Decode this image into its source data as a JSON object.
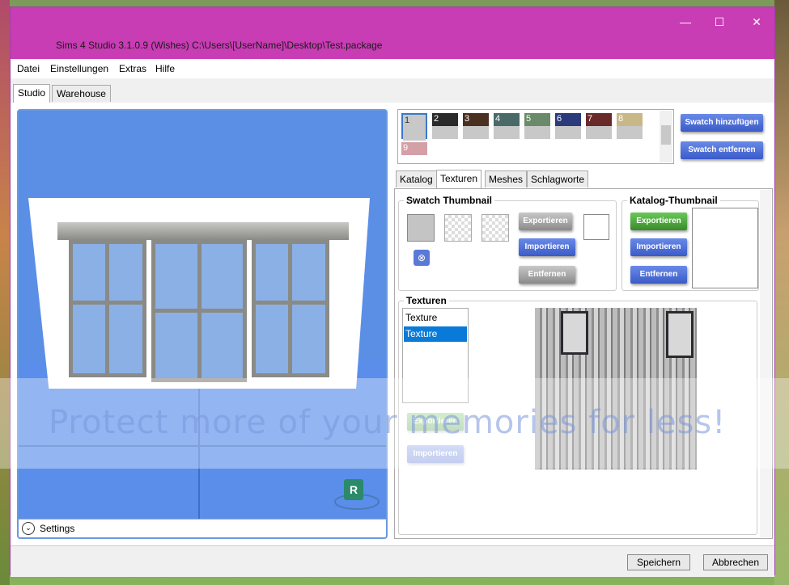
{
  "window": {
    "title": "Sims 4 Studio 3.1.0.9 (Wishes)  C:\\Users\\[UserName]\\Desktop\\Test.package",
    "controls": {
      "minimize": "—",
      "maximize": "☐",
      "close": "✕"
    }
  },
  "menu": [
    "Datei",
    "Einstellungen",
    "Extras",
    "Hilfe"
  ],
  "main_tabs": [
    "Studio",
    "Warehouse"
  ],
  "preview": {
    "settings_label": "Settings",
    "chevron": "⌄",
    "badge": "R"
  },
  "swatches": [
    {
      "num": "1",
      "color": "#c8c8c8",
      "selected": true
    },
    {
      "num": "2",
      "color": "#2a2a2a"
    },
    {
      "num": "3",
      "color": "#4a3020"
    },
    {
      "num": "4",
      "color": "#4a6a6a"
    },
    {
      "num": "5",
      "color": "#6a8a6a"
    },
    {
      "num": "6",
      "color": "#2a3a7a"
    },
    {
      "num": "7",
      "color": "#6a2a2a"
    },
    {
      "num": "8",
      "color": "#c8b888"
    },
    {
      "num": "9",
      "color": "#d4a0a8"
    }
  ],
  "swatch_buttons": {
    "add": "Swatch hinzufügen",
    "remove": "Swatch entfernen"
  },
  "sub_tabs": [
    "Katalog",
    "Texturen",
    "Meshes",
    "Schlagworte"
  ],
  "swatch_thumbnail": {
    "title": "Swatch Thumbnail",
    "export": "Exportieren",
    "import": "Importieren",
    "remove": "Entfernen"
  },
  "catalog_thumbnail": {
    "title": "Katalog-Thumbnail",
    "export": "Exportieren",
    "import": "Importieren",
    "remove": "Entfernen"
  },
  "textures": {
    "title": "Texturen",
    "items": [
      "Texture",
      "Texture"
    ],
    "export": "Exportieren",
    "import": "Importieren"
  },
  "footer": {
    "save": "Speichern",
    "cancel": "Abbrechen"
  },
  "watermark": "Protect more of your memories for less!"
}
